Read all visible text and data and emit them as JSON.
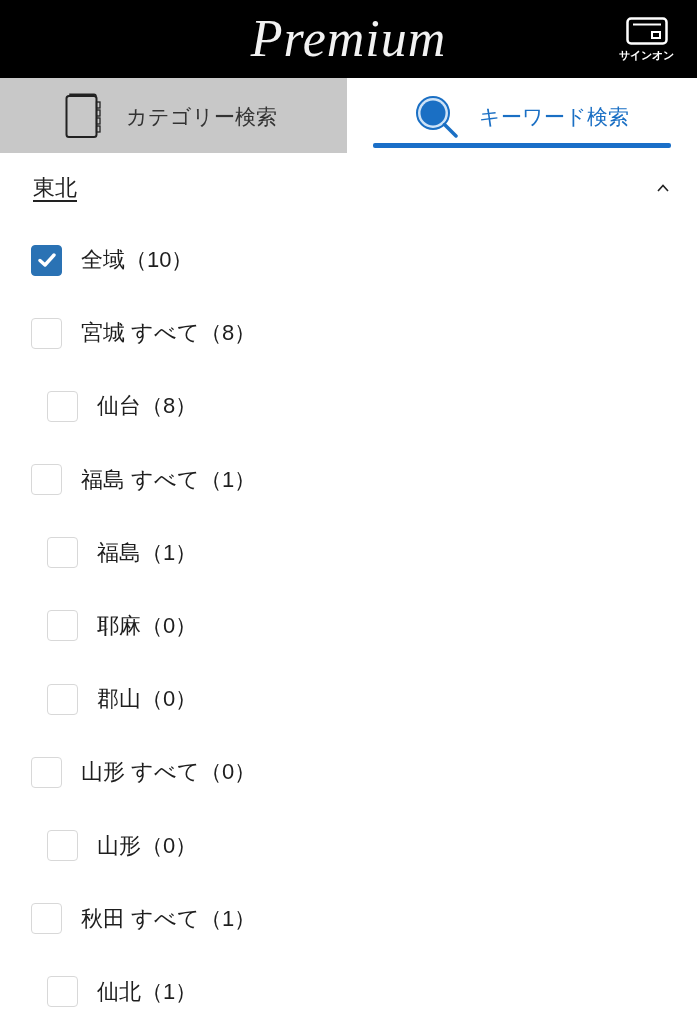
{
  "header": {
    "logo": "Premium",
    "sign_on_label": "サインオン"
  },
  "tabs": [
    {
      "kind": "category",
      "label": "カテゴリー検索",
      "selected": false
    },
    {
      "kind": "keyword",
      "label": "キーワード検索",
      "selected": true
    }
  ],
  "region": {
    "title": "東北",
    "expanded": true,
    "items": [
      {
        "label": "全域（10）",
        "checked": true
      },
      {
        "label": "宮城 すべて（8）",
        "checked": false,
        "children": [
          {
            "label": "仙台（8）",
            "checked": false
          }
        ]
      },
      {
        "label": "福島 すべて（1）",
        "checked": false,
        "children": [
          {
            "label": "福島（1）",
            "checked": false
          },
          {
            "label": "耶麻（0）",
            "checked": false
          },
          {
            "label": "郡山（0）",
            "checked": false
          }
        ]
      },
      {
        "label": "山形 すべて（0）",
        "checked": false,
        "children": [
          {
            "label": "山形（0）",
            "checked": false
          }
        ]
      },
      {
        "label": "秋田 すべて（1）",
        "checked": false,
        "children": [
          {
            "label": "仙北（1）",
            "checked": false
          }
        ]
      }
    ]
  }
}
